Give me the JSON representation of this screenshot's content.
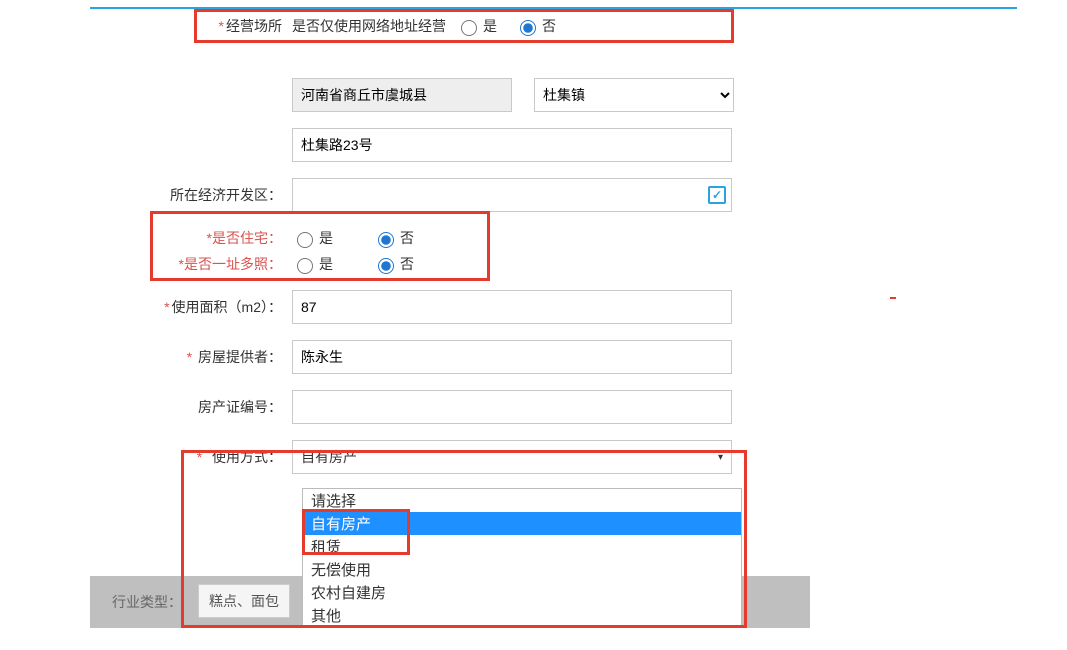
{
  "row1": {
    "label": "经营场所",
    "prompt": "是否仅使用网络地址经营",
    "yes": "是",
    "no": "否"
  },
  "row_region": {
    "locked": "河南省商丘市虞城县",
    "town_selected": "杜集镇"
  },
  "row_addr": {
    "value": "杜集路23号"
  },
  "row_devzone": {
    "label": "所在经济开发区：",
    "value": ""
  },
  "row_isres": {
    "label": "*是否住宅：",
    "yes": "是",
    "no": "否"
  },
  "row_multi": {
    "label": "*是否一址多照：",
    "yes": "是",
    "no": "否"
  },
  "row_area": {
    "label": "使用面积（m2）：",
    "value": "87"
  },
  "row_provider": {
    "label": "房屋提供者：",
    "value": "陈永生"
  },
  "row_cert": {
    "label": "房产证编号：",
    "value": ""
  },
  "row_usage": {
    "label": "使用方式：",
    "selected": "自有房产"
  },
  "usage_options": {
    "o0": "请选择",
    "o1": "自有房产",
    "o2": "租赁",
    "o3": "无偿使用",
    "o4": "农村自建房",
    "o5": "其他"
  },
  "bottom": {
    "industry_label": "行业类型：",
    "industry_btn": "糕点、面包"
  }
}
